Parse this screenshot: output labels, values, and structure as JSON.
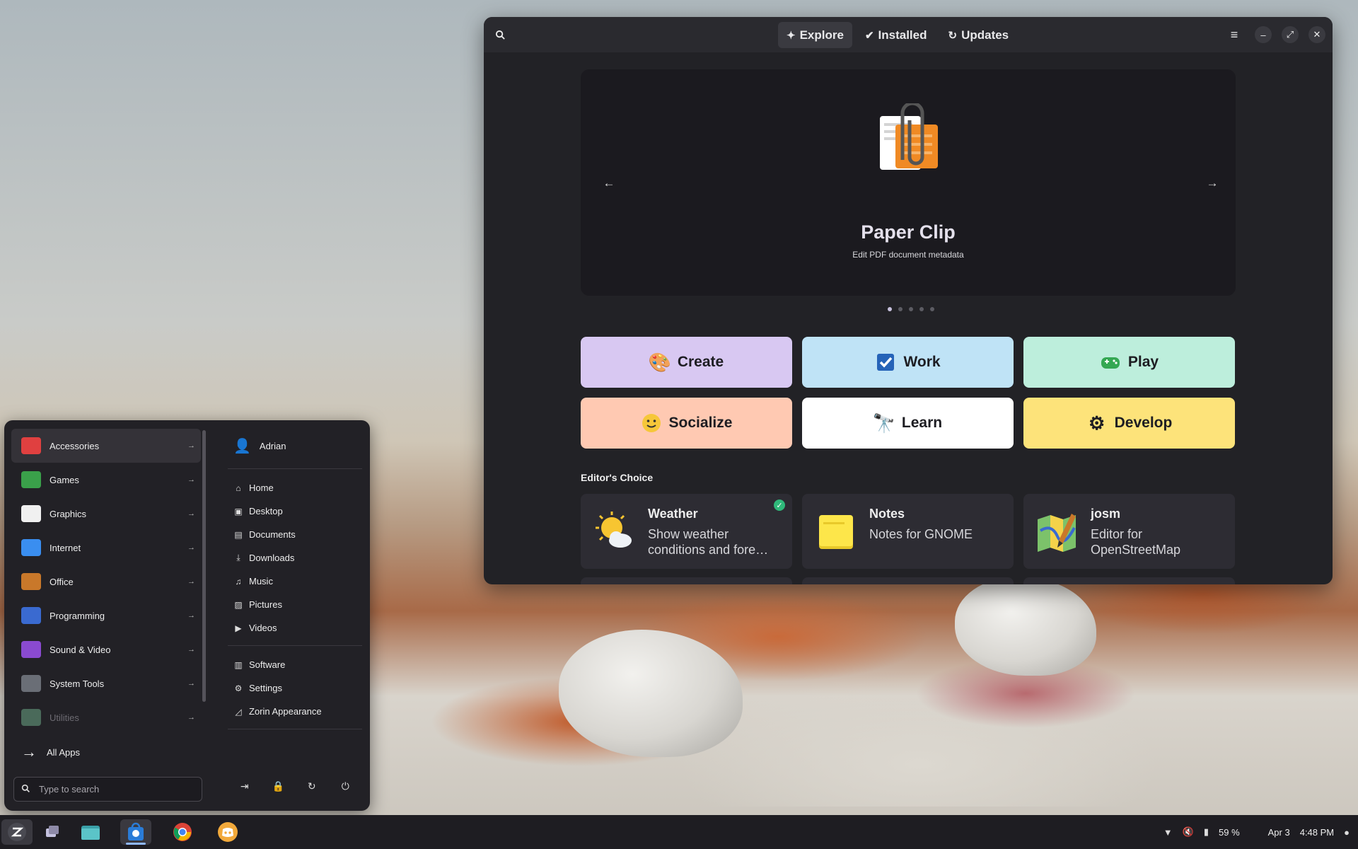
{
  "software": {
    "tabs": [
      {
        "label": "Explore",
        "icon": "sparkle-icon"
      },
      {
        "label": "Installed",
        "icon": "check-circle-icon"
      },
      {
        "label": "Updates",
        "icon": "refresh-icon"
      }
    ],
    "featured": {
      "title": "Paper Clip",
      "subtitle": "Edit PDF document metadata",
      "slide_count": 5,
      "active_slide": 1
    },
    "categories": [
      {
        "label": "Create",
        "color": "#d8c8f2"
      },
      {
        "label": "Work",
        "color": "#bfe3f6"
      },
      {
        "label": "Play",
        "color": "#bdeedc"
      },
      {
        "label": "Socialize",
        "color": "#ffc9b2"
      },
      {
        "label": "Learn",
        "color": "#ffffff"
      },
      {
        "label": "Develop",
        "color": "#fde37a"
      }
    ],
    "section_title": "Editor's Choice",
    "editors_choice": [
      {
        "name": "Weather",
        "desc": "Show weather conditions and fore…",
        "installed": true
      },
      {
        "name": "Notes",
        "desc": "Notes for GNOME",
        "installed": false
      },
      {
        "name": "josm",
        "desc": "Editor for OpenStreetMap",
        "installed": false
      }
    ]
  },
  "start_menu": {
    "categories": [
      {
        "label": "Accessories",
        "color": "#e04040"
      },
      {
        "label": "Games",
        "color": "#3aa04a"
      },
      {
        "label": "Graphics",
        "color": "#f0f0f0"
      },
      {
        "label": "Internet",
        "color": "#3a8ef0"
      },
      {
        "label": "Office",
        "color": "#c9782a"
      },
      {
        "label": "Programming",
        "color": "#3a6ad0"
      },
      {
        "label": "Sound & Video",
        "color": "#8a4ad0"
      },
      {
        "label": "System Tools",
        "color": "#6a6e76"
      },
      {
        "label": "Utilities",
        "color": "#4a6a5a"
      }
    ],
    "all_apps": "All Apps",
    "search_placeholder": "Type to search",
    "user": "Adrian",
    "places": [
      "Home",
      "Desktop",
      "Documents",
      "Downloads",
      "Music",
      "Pictures",
      "Videos"
    ],
    "system": [
      "Software",
      "Settings",
      "Zorin Appearance"
    ]
  },
  "taskbar": {
    "battery": "59 %",
    "date": "Apr 3",
    "time": "4:48 PM"
  }
}
